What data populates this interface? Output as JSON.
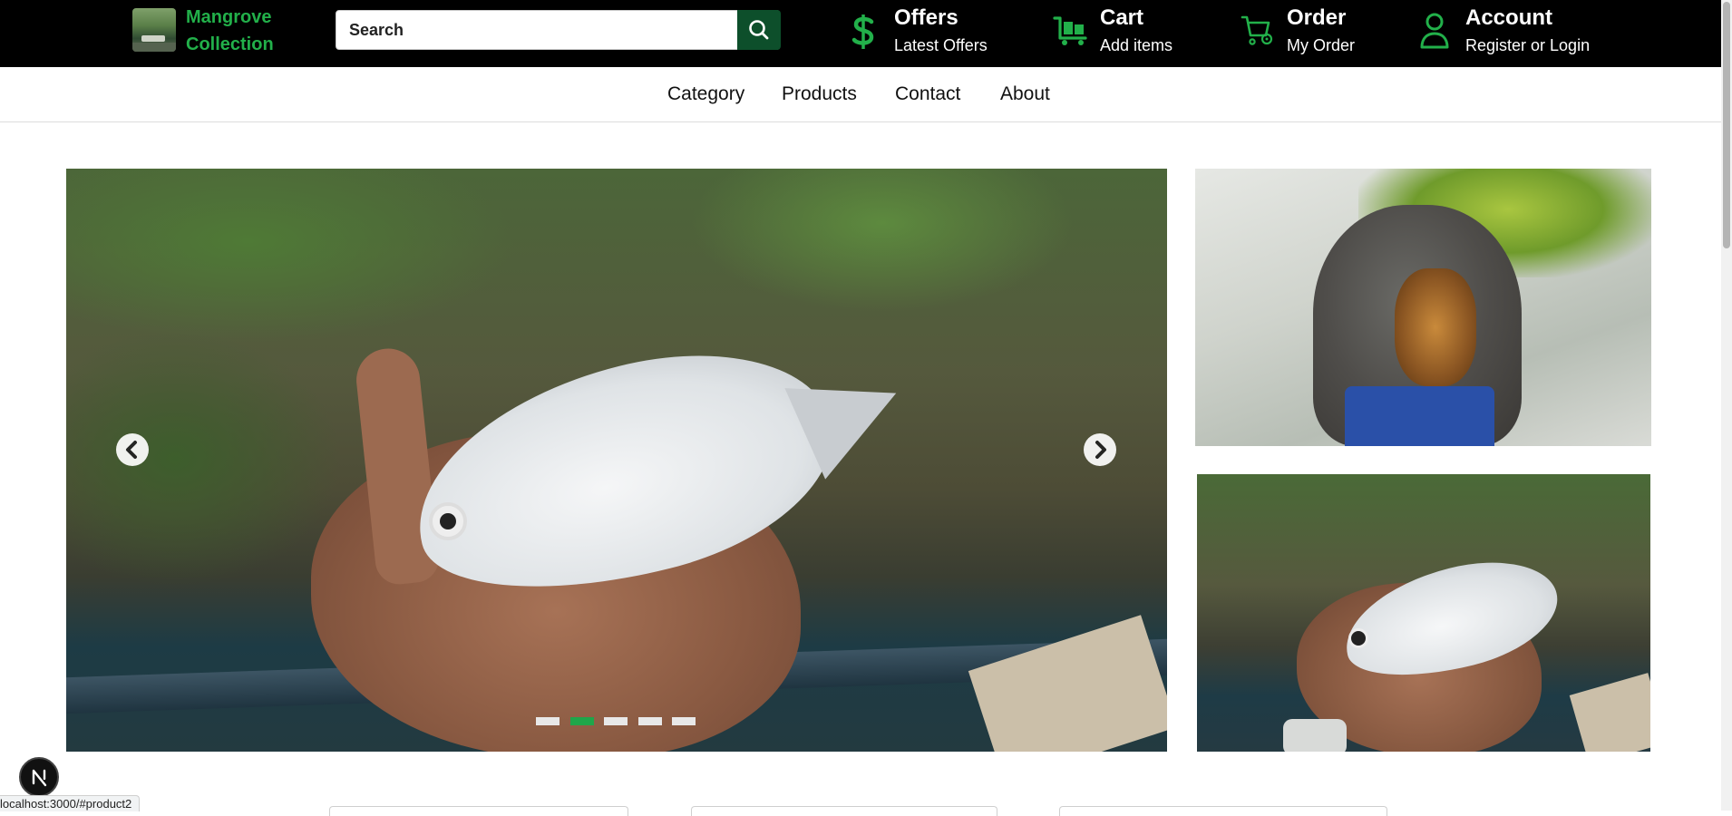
{
  "brand": {
    "name_line1": "Mangrove",
    "name_line2": "Collection",
    "color": "#22b04a"
  },
  "search": {
    "placeholder": "Search",
    "value": "",
    "button_icon": "search-icon"
  },
  "header_nav": [
    {
      "title": "Offers",
      "subtitle": "Latest Offers",
      "icon": "dollar-icon"
    },
    {
      "title": "Cart",
      "subtitle": "Add items",
      "icon": "cart-icon"
    },
    {
      "title": "Order",
      "subtitle": "My Order",
      "icon": "order-cart-icon"
    },
    {
      "title": "Account",
      "subtitle": "Register or Login",
      "icon": "user-icon"
    }
  ],
  "main_nav": [
    "Category",
    "Products",
    "Contact",
    "About"
  ],
  "carousel": {
    "slide_count": 5,
    "active_index": 1,
    "prev_icon": "chevron-left-icon",
    "next_icon": "chevron-right-icon"
  },
  "status_bar": {
    "url": "localhost:3000/#product2"
  },
  "colors": {
    "accent": "#1fa64a",
    "header_bg": "#000000",
    "search_button": "#0d4f2b"
  }
}
